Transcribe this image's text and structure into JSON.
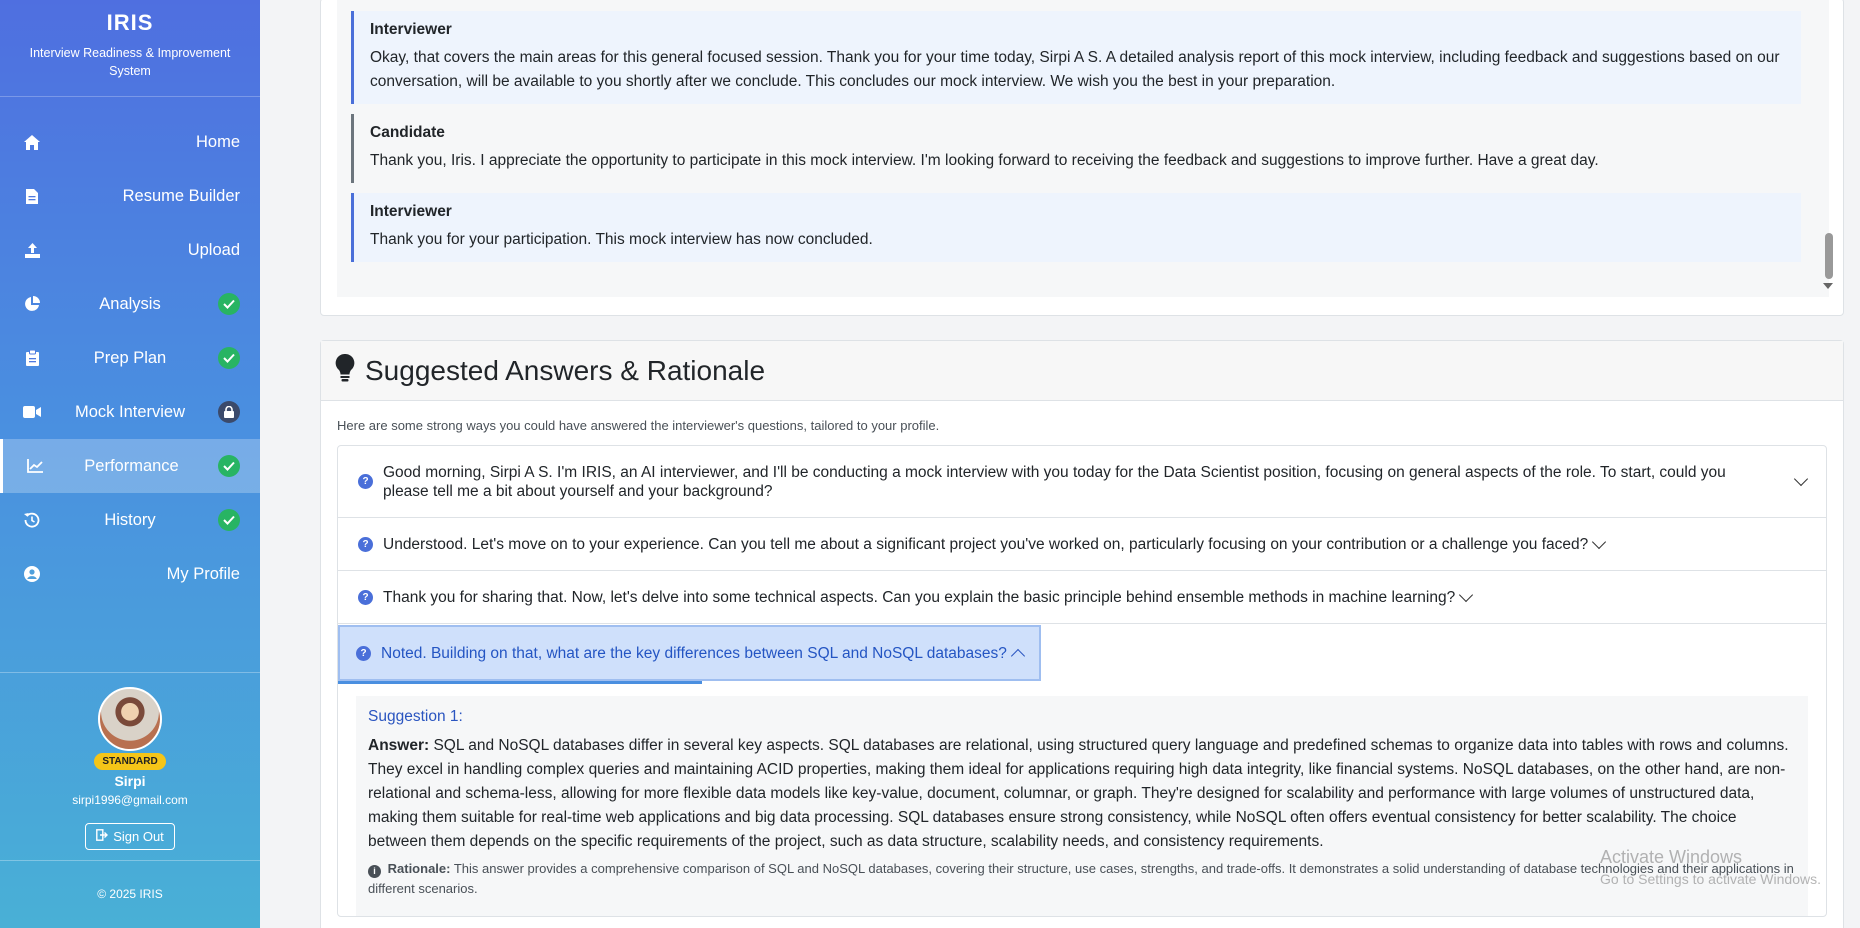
{
  "sidebar": {
    "brand": "IRIS",
    "brand_subtitle": "Interview Readiness & Improvement System",
    "items": [
      {
        "label": "Home",
        "icon": "home-icon",
        "status": "none"
      },
      {
        "label": "Resume Builder",
        "icon": "file-icon",
        "status": "none"
      },
      {
        "label": "Upload",
        "icon": "upload-icon",
        "status": "none"
      },
      {
        "label": "Analysis",
        "icon": "pie-chart-icon",
        "status": "complete"
      },
      {
        "label": "Prep Plan",
        "icon": "clipboard-icon",
        "status": "complete"
      },
      {
        "label": "Mock Interview",
        "icon": "video-icon",
        "status": "locked"
      },
      {
        "label": "Performance",
        "icon": "line-chart-icon",
        "status": "complete",
        "active": true
      },
      {
        "label": "History",
        "icon": "history-icon",
        "status": "complete"
      },
      {
        "label": "My Profile",
        "icon": "user-circle-icon",
        "status": "none"
      }
    ],
    "user": {
      "plan": "STANDARD",
      "name": "Sirpi",
      "email": "sirpi1996@gmail.com",
      "sign_out": "Sign Out"
    },
    "copyright": "© 2025 IRIS"
  },
  "transcript": {
    "messages": [
      {
        "role": "Interviewer",
        "text": "Okay, that covers the main areas for this general focused session. Thank you for your time today, Sirpi A S. A detailed analysis report of this mock interview, including feedback and suggestions based on our conversation, will be available to you shortly after we conclude. This concludes our mock interview. We wish you the best in your preparation."
      },
      {
        "role": "Candidate",
        "text": "Thank you, Iris. I appreciate the opportunity to participate in this mock interview. I'm looking forward to receiving the feedback and suggestions to improve further. Have a great day."
      },
      {
        "role": "Interviewer",
        "text": "Thank you for your participation. This mock interview has now concluded."
      }
    ]
  },
  "suggested": {
    "title": "Suggested Answers & Rationale",
    "intro": "Here are some strong ways you could have answered the interviewer's questions, tailored to your profile.",
    "questions": [
      "Good morning, Sirpi A S. I'm IRIS, an AI interviewer, and I'll be conducting a mock interview with you today for the Data Scientist position, focusing on general aspects of the role. To start, could you please tell me a bit about yourself and your background?",
      "Understood. Let's move on to your experience. Can you tell me about a significant project you've worked on, particularly focusing on your contribution or a challenge you faced?",
      "Thank you for sharing that. Now, let's delve into some technical aspects. Can you explain the basic principle behind ensemble methods in machine learning?",
      "Noted. Building on that, what are the key differences between SQL and NoSQL databases?"
    ],
    "open_suggestion": {
      "title": "Suggestion 1:",
      "answer_label": "Answer:",
      "answer": "SQL and NoSQL databases differ in several key aspects. SQL databases are relational, using structured query language and predefined schemas to organize data into tables with rows and columns. They excel in handling complex queries and maintaining ACID properties, making them ideal for applications requiring high data integrity, like financial systems. NoSQL databases, on the other hand, are non-relational and schema-less, allowing for more flexible data models like key-value, document, columnar, or graph. They're designed for scalability and performance with large volumes of unstructured data, making them suitable for real-time web applications and big data processing. SQL databases ensure strong consistency, while NoSQL often offers eventual consistency for better scalability. The choice between them depends on the specific requirements of the project, such as data structure, scalability needs, and consistency requirements.",
      "rationale_label": "Rationale:",
      "rationale": "This answer provides a comprehensive comparison of SQL and NoSQL databases, covering their structure, use cases, strengths, and trade-offs. It demonstrates a solid understanding of database technologies and their applications in different scenarios."
    }
  },
  "watermark": {
    "title": "Activate Windows",
    "subtitle": "Go to Settings to activate Windows."
  }
}
